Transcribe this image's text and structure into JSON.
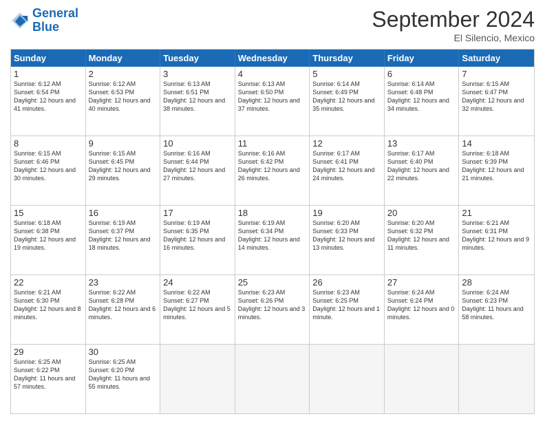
{
  "header": {
    "logo_general": "General",
    "logo_blue": "Blue",
    "month_title": "September 2024",
    "subtitle": "El Silencio, Mexico"
  },
  "days_of_week": [
    "Sunday",
    "Monday",
    "Tuesday",
    "Wednesday",
    "Thursday",
    "Friday",
    "Saturday"
  ],
  "weeks": [
    [
      {
        "day": "1",
        "sunrise": "6:12 AM",
        "sunset": "6:54 PM",
        "daylight": "12 hours and 41 minutes."
      },
      {
        "day": "2",
        "sunrise": "6:12 AM",
        "sunset": "6:53 PM",
        "daylight": "12 hours and 40 minutes."
      },
      {
        "day": "3",
        "sunrise": "6:13 AM",
        "sunset": "6:51 PM",
        "daylight": "12 hours and 38 minutes."
      },
      {
        "day": "4",
        "sunrise": "6:13 AM",
        "sunset": "6:50 PM",
        "daylight": "12 hours and 37 minutes."
      },
      {
        "day": "5",
        "sunrise": "6:14 AM",
        "sunset": "6:49 PM",
        "daylight": "12 hours and 35 minutes."
      },
      {
        "day": "6",
        "sunrise": "6:14 AM",
        "sunset": "6:48 PM",
        "daylight": "12 hours and 34 minutes."
      },
      {
        "day": "7",
        "sunrise": "6:15 AM",
        "sunset": "6:47 PM",
        "daylight": "12 hours and 32 minutes."
      }
    ],
    [
      {
        "day": "8",
        "sunrise": "6:15 AM",
        "sunset": "6:46 PM",
        "daylight": "12 hours and 30 minutes."
      },
      {
        "day": "9",
        "sunrise": "6:15 AM",
        "sunset": "6:45 PM",
        "daylight": "12 hours and 29 minutes."
      },
      {
        "day": "10",
        "sunrise": "6:16 AM",
        "sunset": "6:44 PM",
        "daylight": "12 hours and 27 minutes."
      },
      {
        "day": "11",
        "sunrise": "6:16 AM",
        "sunset": "6:42 PM",
        "daylight": "12 hours and 26 minutes."
      },
      {
        "day": "12",
        "sunrise": "6:17 AM",
        "sunset": "6:41 PM",
        "daylight": "12 hours and 24 minutes."
      },
      {
        "day": "13",
        "sunrise": "6:17 AM",
        "sunset": "6:40 PM",
        "daylight": "12 hours and 22 minutes."
      },
      {
        "day": "14",
        "sunrise": "6:18 AM",
        "sunset": "6:39 PM",
        "daylight": "12 hours and 21 minutes."
      }
    ],
    [
      {
        "day": "15",
        "sunrise": "6:18 AM",
        "sunset": "6:38 PM",
        "daylight": "12 hours and 19 minutes."
      },
      {
        "day": "16",
        "sunrise": "6:19 AM",
        "sunset": "6:37 PM",
        "daylight": "12 hours and 18 minutes."
      },
      {
        "day": "17",
        "sunrise": "6:19 AM",
        "sunset": "6:35 PM",
        "daylight": "12 hours and 16 minutes."
      },
      {
        "day": "18",
        "sunrise": "6:19 AM",
        "sunset": "6:34 PM",
        "daylight": "12 hours and 14 minutes."
      },
      {
        "day": "19",
        "sunrise": "6:20 AM",
        "sunset": "6:33 PM",
        "daylight": "12 hours and 13 minutes."
      },
      {
        "day": "20",
        "sunrise": "6:20 AM",
        "sunset": "6:32 PM",
        "daylight": "12 hours and 11 minutes."
      },
      {
        "day": "21",
        "sunrise": "6:21 AM",
        "sunset": "6:31 PM",
        "daylight": "12 hours and 9 minutes."
      }
    ],
    [
      {
        "day": "22",
        "sunrise": "6:21 AM",
        "sunset": "6:30 PM",
        "daylight": "12 hours and 8 minutes."
      },
      {
        "day": "23",
        "sunrise": "6:22 AM",
        "sunset": "6:28 PM",
        "daylight": "12 hours and 6 minutes."
      },
      {
        "day": "24",
        "sunrise": "6:22 AM",
        "sunset": "6:27 PM",
        "daylight": "12 hours and 5 minutes."
      },
      {
        "day": "25",
        "sunrise": "6:23 AM",
        "sunset": "6:26 PM",
        "daylight": "12 hours and 3 minutes."
      },
      {
        "day": "26",
        "sunrise": "6:23 AM",
        "sunset": "6:25 PM",
        "daylight": "12 hours and 1 minute."
      },
      {
        "day": "27",
        "sunrise": "6:24 AM",
        "sunset": "6:24 PM",
        "daylight": "12 hours and 0 minutes."
      },
      {
        "day": "28",
        "sunrise": "6:24 AM",
        "sunset": "6:23 PM",
        "daylight": "11 hours and 58 minutes."
      }
    ],
    [
      {
        "day": "29",
        "sunrise": "6:25 AM",
        "sunset": "6:22 PM",
        "daylight": "11 hours and 57 minutes."
      },
      {
        "day": "30",
        "sunrise": "6:25 AM",
        "sunset": "6:20 PM",
        "daylight": "11 hours and 55 minutes."
      },
      null,
      null,
      null,
      null,
      null
    ]
  ]
}
